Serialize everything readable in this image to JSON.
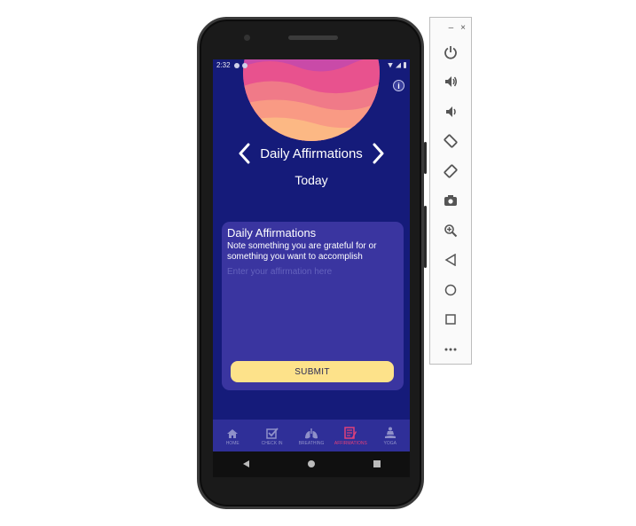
{
  "status_bar": {
    "time": "2:32"
  },
  "screen": {
    "title": "Daily Affirmations",
    "date_label": "Today",
    "info_icon": "info-icon"
  },
  "card": {
    "title": "Daily Affirmations",
    "description": "Note something you are grateful for or something you want to accomplish",
    "input_value": "",
    "input_placeholder": "Enter your affirmation here",
    "submit_label": "SUBMIT"
  },
  "tabs": [
    {
      "label": "HOME",
      "icon": "home-icon",
      "active": false
    },
    {
      "label": "CHECK IN",
      "icon": "checkbox-icon",
      "active": false
    },
    {
      "label": "BREATHING",
      "icon": "lungs-icon",
      "active": false
    },
    {
      "label": "AFFIRMATIONS",
      "icon": "note-icon",
      "active": true
    },
    {
      "label": "YOGA",
      "icon": "meditation-icon",
      "active": false
    }
  ],
  "nav_buttons": [
    "back-icon",
    "home-circle-icon",
    "recents-icon"
  ],
  "emulator": {
    "window_controls": {
      "minimize": "–",
      "close": "×"
    },
    "buttons": [
      "power-icon",
      "volume-up-icon",
      "volume-down-icon",
      "rotate-left-icon",
      "rotate-right-icon",
      "camera-icon",
      "zoom-icon",
      "back-icon",
      "home-icon",
      "overview-icon",
      "more-icon"
    ]
  },
  "colors": {
    "screen_bg": "#151b7a",
    "card_bg": "#3a35a0",
    "submit_bg": "#fde28a",
    "tab_active": "#e0407a",
    "tab_inactive": "#8f90c9"
  }
}
